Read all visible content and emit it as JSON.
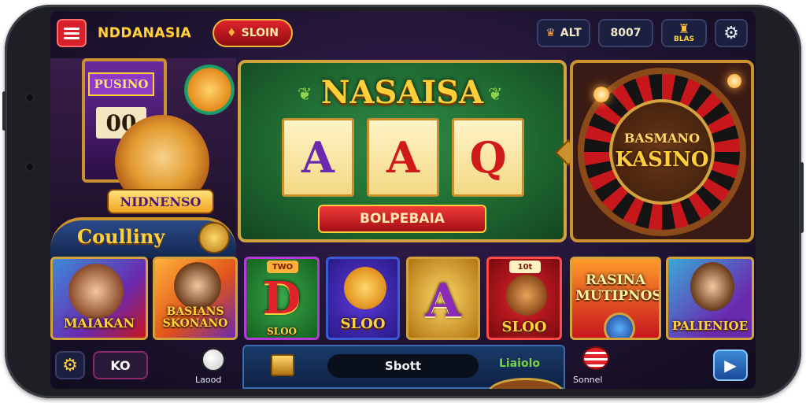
{
  "header": {
    "brand": "NDDANASIA",
    "login_label": "SLOIN",
    "alt_label": "ALT",
    "balance": "8007",
    "reward_label": "BLAS"
  },
  "left_panel": {
    "sign_top": "PUSINO",
    "sign_digits": "00",
    "banner": "NIDNENSO",
    "table_text": "Coulliny"
  },
  "featured": {
    "title": "NASAISA",
    "reels": [
      "A",
      "A",
      "Q"
    ],
    "play_label": "BOLPEBAIA"
  },
  "roulette": {
    "top": "BASMANO",
    "main": "KASINO"
  },
  "games": [
    {
      "label": "MAIAKAN"
    },
    {
      "label": "BASIANS SKONANO"
    },
    {
      "label": "SLOO",
      "tag": "TWO",
      "big": "D"
    },
    {
      "label": "SLOO"
    },
    {
      "label": "",
      "big": "A"
    },
    {
      "label": "SLOO",
      "tag": "10t"
    },
    {
      "label": "RASINA MUTIPNOS"
    },
    {
      "label": "PALIENIOE"
    }
  ],
  "bottom": {
    "counter": "KO",
    "loaded_label": "Laood",
    "search_label": "Sbott",
    "status_label": "Liaiolo",
    "social_label": "Sonnel"
  },
  "colors": {
    "accent_red": "#c8161d",
    "gold": "#ffcf3a",
    "felt_green": "#1f6b33",
    "nav_blue": "#1c2040"
  }
}
